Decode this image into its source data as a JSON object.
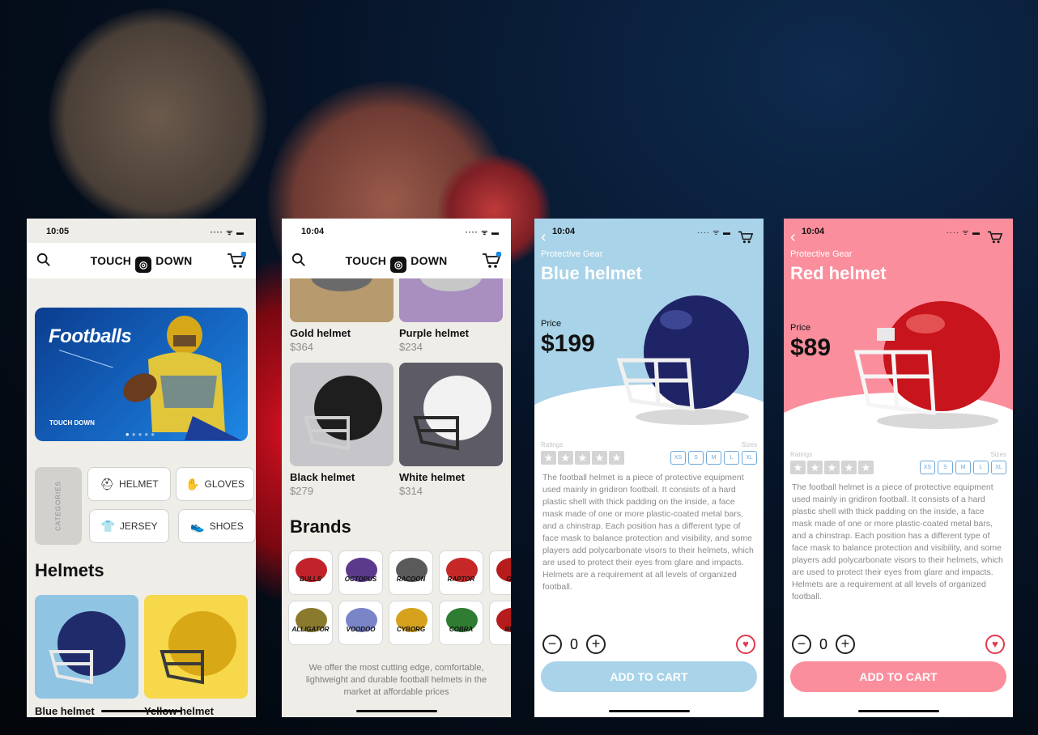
{
  "screens": {
    "home": {
      "time": "10:05",
      "logo_left": "TOUCH",
      "logo_right": "DOWN",
      "banner_title": "Footballs",
      "banner_logo": "TOUCH DOWN",
      "categories_label": "CATEGORIES",
      "chips": [
        {
          "label": "HELMET",
          "icon": "helmet-icon"
        },
        {
          "label": "GLOVES",
          "icon": "gloves-icon"
        },
        {
          "label": "JERSEY",
          "icon": "jersey-icon"
        },
        {
          "label": "SHOES",
          "icon": "shoe-icon"
        }
      ],
      "section_title": "Helmets",
      "products": [
        {
          "name": "Blue helmet"
        },
        {
          "name": "Yellow helmet"
        }
      ]
    },
    "catalog": {
      "time": "10:04",
      "logo_left": "TOUCH",
      "logo_right": "DOWN",
      "products": [
        {
          "name": "Gold helmet",
          "price": "$364"
        },
        {
          "name": "Purple helmet",
          "price": "$234"
        },
        {
          "name": "Black helmet",
          "price": "$279"
        },
        {
          "name": "White helmet",
          "price": "$314"
        }
      ],
      "brands_title": "Brands",
      "brands": [
        "BULLS",
        "OCTOPUS",
        "RACOON",
        "RAPTOR",
        "GO",
        "ALLIGATOR",
        "VOODOO",
        "CYBORG",
        "COBRA",
        "BUL"
      ],
      "description": "We offer the most cutting edge, comfortable, lightweight and durable football helmets in the market at affordable prices"
    },
    "blue_detail": {
      "time": "10:04",
      "category": "Protective Gear",
      "title": "Blue helmet",
      "price_label": "Price",
      "price": "$199",
      "ratings_label": "Ratings",
      "sizes_label": "Sizes",
      "sizes": [
        "XS",
        "S",
        "M",
        "L",
        "XL"
      ],
      "description": "The football helmet is a piece of protective equipment used mainly in gridiron football. It consists of a hard plastic shell with thick padding on the inside, a face mask made of one or more plastic-coated metal bars, and a chinstrap. Each position has a different type of face mask to balance protection and visibility, and some players add polycarbonate visors to their helmets, which are used to protect their eyes from glare and impacts. Helmets are a requirement at all levels of organized football.",
      "quantity": "0",
      "add_to_cart": "ADD TO CART",
      "accent": "#a9d3e8"
    },
    "red_detail": {
      "time": "10:04",
      "category": "Protective Gear",
      "title": "Red helmet",
      "price_label": "Price",
      "price": "$89",
      "ratings_label": "Ratings",
      "sizes_label": "Sizes",
      "sizes": [
        "XS",
        "S",
        "M",
        "L",
        "XL"
      ],
      "description": "The football helmet is a piece of protective equipment used mainly in gridiron football. It consists of a hard plastic shell with thick padding on the inside, a face mask made of one or more plastic-coated metal bars, and a chinstrap. Each position has a different type of face mask to balance protection and visibility, and some players add polycarbonate visors to their helmets, which are used to protect their eyes from glare and impacts. Helmets are a requirement at all levels of organized football.",
      "quantity": "0",
      "add_to_cart": "ADD TO CART",
      "accent": "#fb8e9c"
    }
  }
}
